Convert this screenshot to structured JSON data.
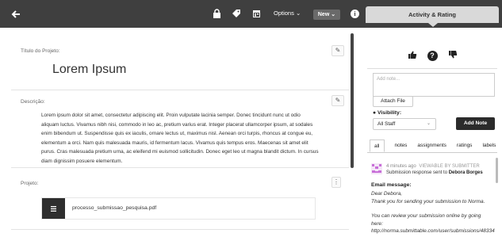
{
  "topbar": {
    "options_label": "Options",
    "new_label": "New",
    "info_label": "i",
    "activity_tab_label": "Activity & Rating"
  },
  "main": {
    "title_section_label": "Título do Projeto:",
    "title_value": "Lorem Ipsum",
    "description_label": "Descrição:",
    "description_text": "Lorem ipsum dolor sit amet, consectetur adipiscing elit. Proin vulputate lacinia semper. Donec tincidunt nunc ut odio aliquam luctus. Vivamus nibh nisi, commodo in leo ac, pretium varius erat. Integer placerat ullamcorper ipsum, at sodales enim bibendum ut. Suspendisse quis ex iaculis, ornare lectus ut, maximus nisl. Aenean orci turpis, rhoncus at congue eu, elementum a orci. Nam quis malesuada mauris, id fermentum lacus. Vivamus quis tempus eros. Maecenas sit amet elit purus. Cras malesuada pretium urna, ac eleifend mi euismod sollicitudin. Donec eget leo ut magna blandit dictum. In cursus diam dignissim posuere elementum.",
    "project_label": "Projeto:",
    "file_name": "processo_submissao_pesquisa.pdf"
  },
  "sidebar": {
    "note_placeholder": "Add note...",
    "attach_file_label": "Attach File",
    "visibility_label": "Visibility:",
    "visibility_value": "All Staff",
    "add_note_label": "Add Note",
    "tabs": [
      {
        "label": "all"
      },
      {
        "label": "notes"
      },
      {
        "label": "assignments"
      },
      {
        "label": "ratings"
      },
      {
        "label": "labels"
      }
    ],
    "activity": {
      "time": "4 minutes ago",
      "visibility": "VIEWABLE BY SUBMITTER",
      "action": "Submission response sent to",
      "recipient": "Debora Borges",
      "email_label": "Email message:",
      "email_greeting": "Dear Debora,",
      "email_line1": "Thank you for sending your submission to Norma.",
      "email_line2": "You can review your submission online by going here:",
      "email_link": "http://norma.submittable.com/user/submissions/48334"
    }
  }
}
